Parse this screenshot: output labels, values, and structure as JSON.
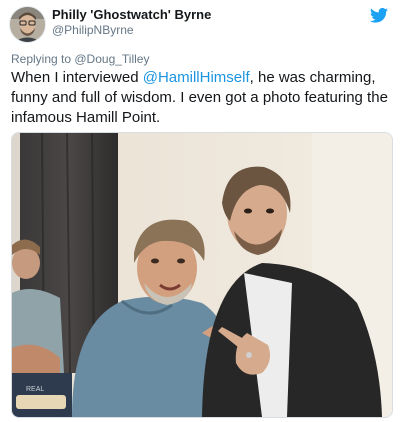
{
  "author": {
    "display_name": "Philly 'Ghostwatch' Byrne",
    "handle": "@PhilipNByrne"
  },
  "reply": {
    "prefix": "Replying to ",
    "to_handle": "@Doug_Tilley"
  },
  "tweet": {
    "text_before": "When I interviewed ",
    "mention": "@HamillHimself",
    "text_after": ", he was charming, funny and full of wisdom. I even got a photo featuring the infamous Hamill Point."
  },
  "photo": {
    "bag_text": "REAL"
  },
  "colors": {
    "accent": "#1da1f2",
    "mention": "#1b95e0",
    "secondary_text": "#657786"
  },
  "icons": {
    "brand": "twitter-bird-icon"
  }
}
